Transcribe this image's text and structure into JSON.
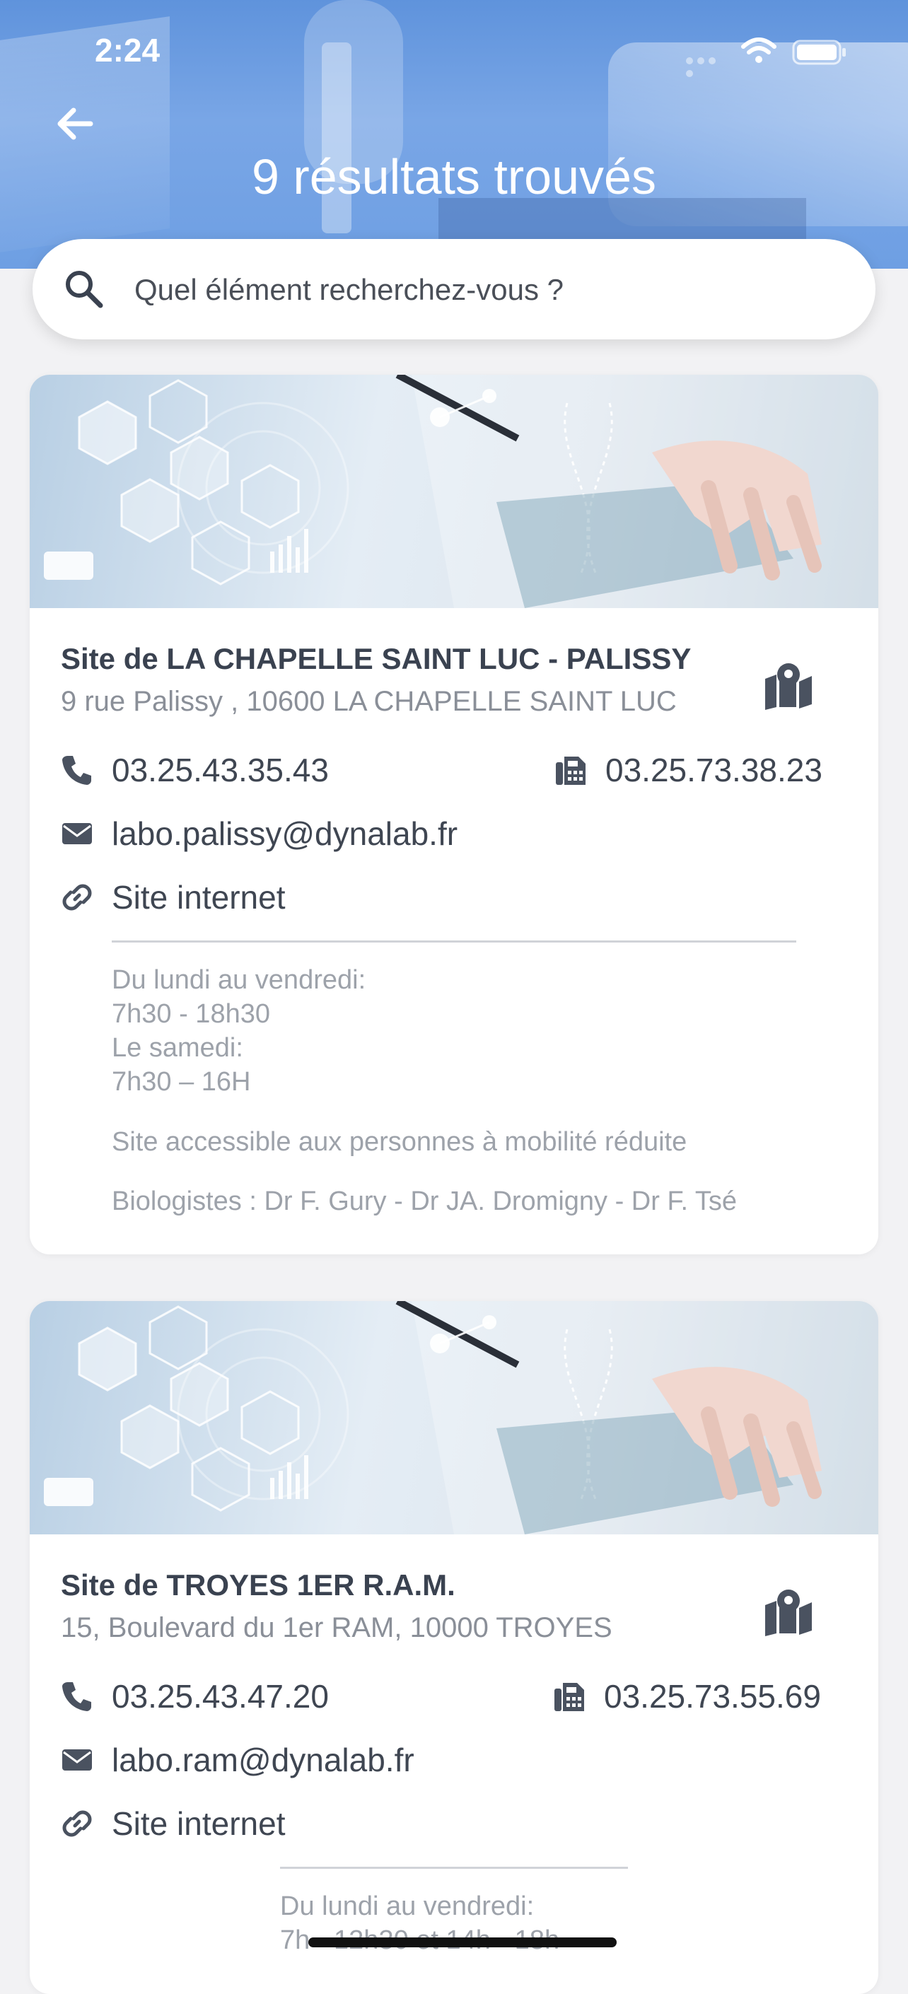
{
  "status_bar": {
    "time": "2:24"
  },
  "header": {
    "title": "9 résultats trouvés"
  },
  "search": {
    "placeholder": "Quel élément recherchez-vous ?"
  },
  "icons": {
    "back": "arrow-left-icon",
    "search": "magnifier-icon",
    "map": "map-pin-icon",
    "phone": "phone-icon",
    "fax": "fax-icon",
    "email": "envelope-icon",
    "link": "link-icon"
  },
  "colors": {
    "header": "#6e9fe3",
    "text": "#3f4652",
    "muted": "#9da2aa"
  },
  "results": [
    {
      "name": "Site de LA CHAPELLE SAINT LUC - PALISSY",
      "address": "9 rue Palissy , 10600 LA CHAPELLE SAINT LUC",
      "phone": "03.25.43.35.43",
      "fax": "03.25.73.38.23",
      "email": "labo.palissy@dynalab.fr",
      "website_label": "Site internet",
      "hours": [
        "Du lundi au vendredi:",
        "7h30 - 18h30",
        "Le samedi:",
        "7h30 – 16H"
      ],
      "accessibility": "Site accessible aux personnes à mobilité réduite",
      "biologists": "Biologistes : Dr F. Gury - Dr JA. Dromigny - Dr F. Tsé"
    },
    {
      "name": "Site de TROYES 1ER R.A.M.",
      "address": "15, Boulevard du 1er RAM, 10000 TROYES",
      "phone": "03.25.43.47.20",
      "fax": "03.25.73.55.69",
      "email": "labo.ram@dynalab.fr",
      "website_label": "Site internet",
      "hours": [
        "Du lundi au vendredi:",
        "7h - 12h30 et 14h - 18h"
      ]
    }
  ]
}
